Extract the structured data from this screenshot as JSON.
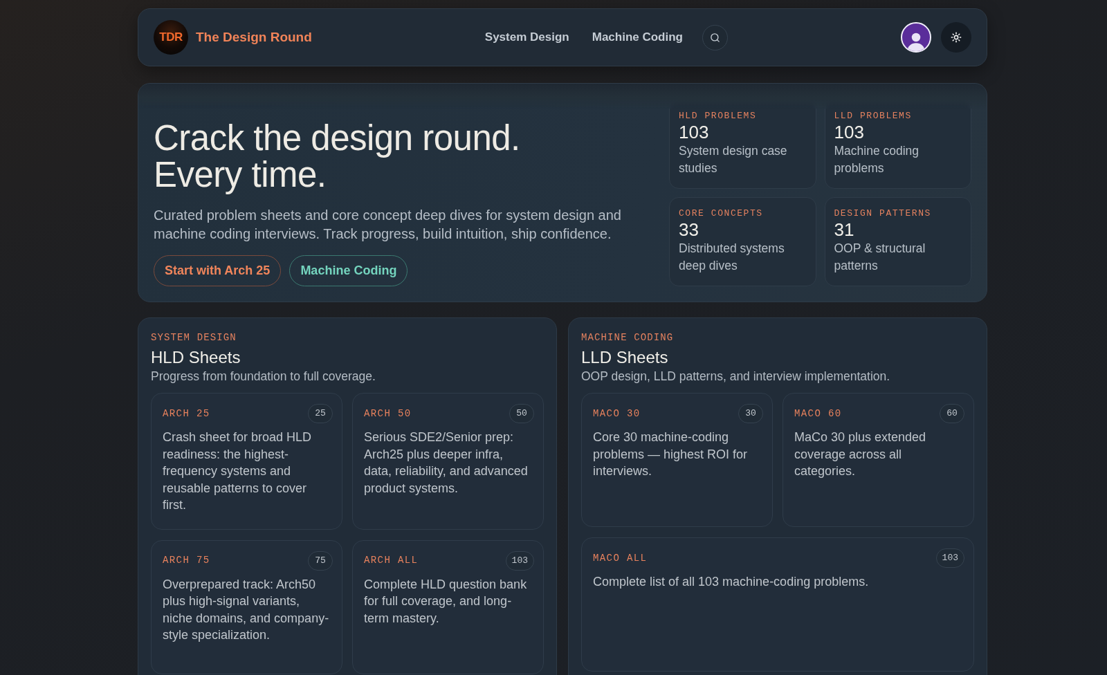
{
  "header": {
    "logo_text": "TDR",
    "title": "The Design Round",
    "nav": [
      "System Design",
      "Machine Coding"
    ]
  },
  "hero": {
    "headline": "Crack the design round. Every time.",
    "description": "Curated problem sheets and core concept deep dives for system design and machine coding interviews. Track progress, build intuition, ship confidence.",
    "buttons": [
      {
        "label": "Start with Arch 25",
        "kind": "primary"
      },
      {
        "label": "Machine Coding",
        "kind": "secondary"
      }
    ],
    "stats": [
      {
        "label": "HLD PROBLEMS",
        "value": "103",
        "description": "System design case studies"
      },
      {
        "label": "LLD PROBLEMS",
        "value": "103",
        "description": "Machine coding problems"
      },
      {
        "label": "CORE CONCEPTS",
        "value": "33",
        "description": "Distributed systems deep dives"
      },
      {
        "label": "DESIGN PATTERNS",
        "value": "31",
        "description": "OOP & structural patterns"
      }
    ]
  },
  "sections": [
    {
      "eyebrow": "SYSTEM DESIGN",
      "title": "HLD Sheets",
      "subtitle": "Progress from foundation to full coverage.",
      "sheets": [
        {
          "name": "ARCH 25",
          "count": "25",
          "description": "Crash sheet for broad HLD readiness: the highest-frequency systems and reusable patterns to cover first."
        },
        {
          "name": "ARCH 50",
          "count": "50",
          "description": "Serious SDE2/Senior prep: Arch25 plus deeper infra, data, reliability, and advanced product systems."
        },
        {
          "name": "ARCH 75",
          "count": "75",
          "description": "Overprepared track: Arch50 plus high-signal variants, niche domains, and company-style specialization."
        },
        {
          "name": "ARCH ALL",
          "count": "103",
          "description": "Complete HLD question bank for full coverage, and long-term mastery."
        }
      ]
    },
    {
      "eyebrow": "MACHINE CODING",
      "title": "LLD Sheets",
      "subtitle": "OOP design, LLD patterns, and interview implementation.",
      "sheets": [
        {
          "name": "MACO 30",
          "count": "30",
          "description": "Core 30 machine-coding problems — highest ROI for interviews."
        },
        {
          "name": "MACO 60",
          "count": "60",
          "description": "MaCo 30 plus extended coverage across all categories."
        },
        {
          "name": "MACO ALL",
          "count": "103",
          "description": "Complete list of all 103 machine-coding problems."
        }
      ]
    }
  ]
}
